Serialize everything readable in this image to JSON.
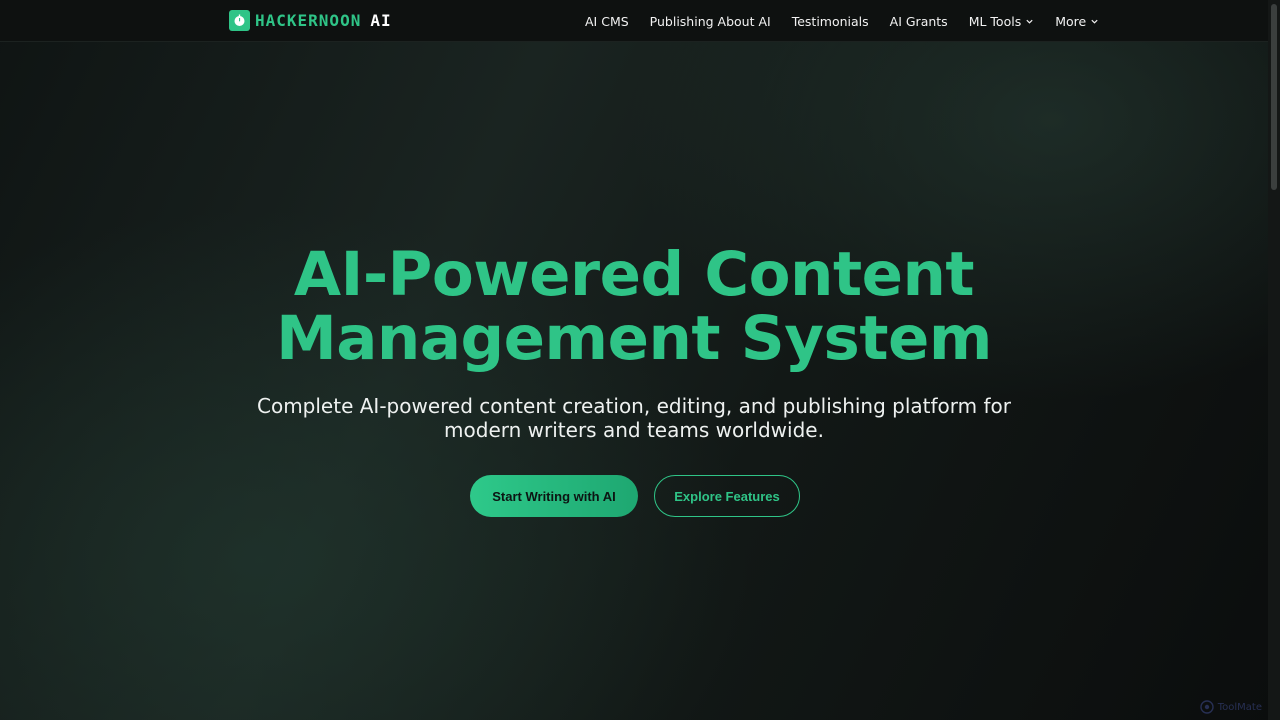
{
  "header": {
    "logo_text": "HACKERNOON",
    "logo_suffix": "AI",
    "nav": [
      {
        "label": "AI CMS"
      },
      {
        "label": "Publishing About AI"
      },
      {
        "label": "Testimonials"
      },
      {
        "label": "AI Grants"
      },
      {
        "label": "ML Tools",
        "dropdown": true
      },
      {
        "label": "More",
        "dropdown": true
      }
    ]
  },
  "hero": {
    "title_line1": "AI-Powered Content",
    "title_line2": "Management System",
    "subtitle_line1": "Complete AI-powered content creation, editing, and publishing platform for",
    "subtitle_line2": "modern writers and teams worldwide.",
    "primary_button": "Start Writing with AI",
    "secondary_button": "Explore Features"
  },
  "watermark": {
    "text": "ToolMate"
  },
  "colors": {
    "accent": "#2fc487",
    "background": "#131918",
    "text": "#eef1f0"
  },
  "icons": {
    "logo": "hackernoon-clock-icon",
    "dropdown": "chevron-down-icon"
  }
}
